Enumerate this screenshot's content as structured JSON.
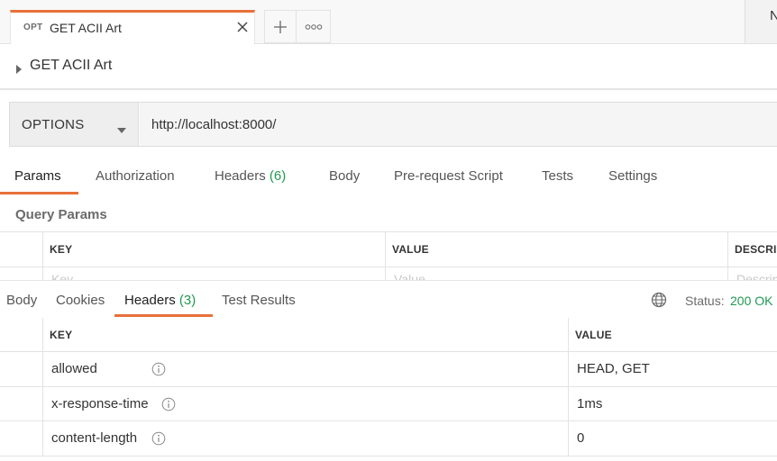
{
  "tabbar": {
    "tab": {
      "method": "OPT",
      "name": "GET ACII Art"
    },
    "env_stub_label": "N"
  },
  "request": {
    "title": "GET ACII Art",
    "method": "OPTIONS",
    "url": "http://localhost:8000/"
  },
  "request_tabs": [
    {
      "label": "Params"
    },
    {
      "label": "Authorization"
    },
    {
      "label": "Headers",
      "count": "(6)"
    },
    {
      "label": "Body"
    },
    {
      "label": "Pre-request Script"
    },
    {
      "label": "Tests"
    },
    {
      "label": "Settings"
    }
  ],
  "query_params": {
    "title": "Query Params",
    "columns": [
      "KEY",
      "VALUE",
      "DESCRIPTION"
    ],
    "placeholders": [
      "Key",
      "Value",
      "Description"
    ]
  },
  "response": {
    "tabs": [
      {
        "label": "Body"
      },
      {
        "label": "Cookies"
      },
      {
        "label": "Headers",
        "count": "(3)"
      },
      {
        "label": "Test Results"
      }
    ],
    "status_label": "Status:",
    "status_value": "200 OK",
    "headers_table": {
      "columns": [
        "KEY",
        "VALUE"
      ],
      "rows": [
        {
          "key": "allowed",
          "value": "HEAD, GET"
        },
        {
          "key": "x-response-time",
          "value": "1ms"
        },
        {
          "key": "content-length",
          "value": "0"
        }
      ]
    }
  },
  "colors": {
    "accent": "#e8703a",
    "success": "#1f9a52"
  }
}
